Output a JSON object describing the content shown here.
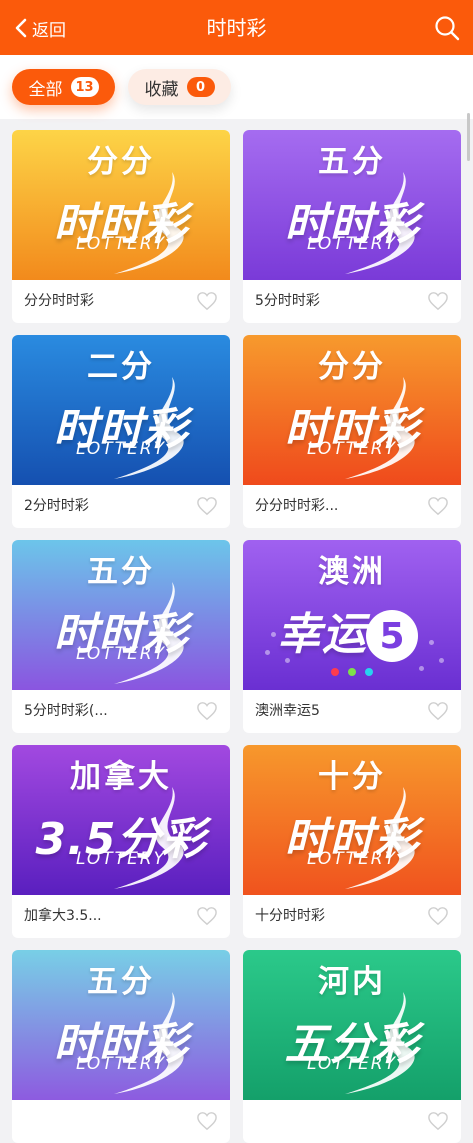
{
  "header": {
    "back_label": "返回",
    "title": "时时彩"
  },
  "filters": {
    "all_label": "全部",
    "all_count": "13",
    "fav_label": "收藏",
    "fav_count": "0"
  },
  "colors": {
    "brand": "#fb5a0b"
  },
  "cards": [
    {
      "top": "分分",
      "big": "时时彩",
      "sub": "LOTTERY",
      "name": "分分时时彩",
      "bg": [
        "#fdd447",
        "#f28a1c"
      ],
      "icon": "heart-outline-icon"
    },
    {
      "top": "五分",
      "big": "时时彩",
      "sub": "LOTTERY",
      "name": "5分时时彩",
      "bg": [
        "#a56cf0",
        "#7a3ad8"
      ],
      "icon": "heart-outline-icon"
    },
    {
      "top": "二分",
      "big": "时时彩",
      "sub": "LOTTERY",
      "name": "2分时时彩",
      "bg": [
        "#2a8be0",
        "#1550b0"
      ],
      "icon": "heart-outline-icon"
    },
    {
      "top": "分分",
      "big": "时时彩",
      "sub": "LOTTERY",
      "name": "分分时时彩...",
      "bg": [
        "#f79a2d",
        "#ef4a1c"
      ],
      "icon": "heart-outline-icon"
    },
    {
      "top": "五分",
      "big": "时时彩",
      "sub": "LOTTERY",
      "name": "5分时时彩(...",
      "bg": [
        "#6cc5ea",
        "#8a55e0"
      ],
      "icon": "heart-outline-icon"
    },
    {
      "top": "澳洲",
      "big": "幸运",
      "badge": "5",
      "name": "澳洲幸运5",
      "bg": [
        "#a061f0",
        "#6a2fd2"
      ],
      "icon": "heart-outline-icon"
    },
    {
      "top": "加拿大",
      "big": "3.5分彩",
      "sub": "LOTTERY",
      "name": "加拿大3.5...",
      "bg": [
        "#a249e0",
        "#5a1fbf"
      ],
      "icon": "heart-outline-icon"
    },
    {
      "top": "十分",
      "big": "时时彩",
      "sub": "LOTTERY",
      "name": "十分时时彩",
      "bg": [
        "#f7982c",
        "#f0531e"
      ],
      "icon": "heart-outline-icon"
    },
    {
      "top": "五分",
      "big": "时时彩",
      "sub": "LOTTERY",
      "name": "",
      "bg": [
        "#78cfe6",
        "#8d5be0"
      ],
      "icon": "heart-outline-icon"
    },
    {
      "top": "河内",
      "big": "五分彩",
      "sub": "LOTTERY",
      "name": "",
      "bg": [
        "#2bc98a",
        "#14a06a"
      ],
      "icon": "heart-outline-icon"
    }
  ]
}
